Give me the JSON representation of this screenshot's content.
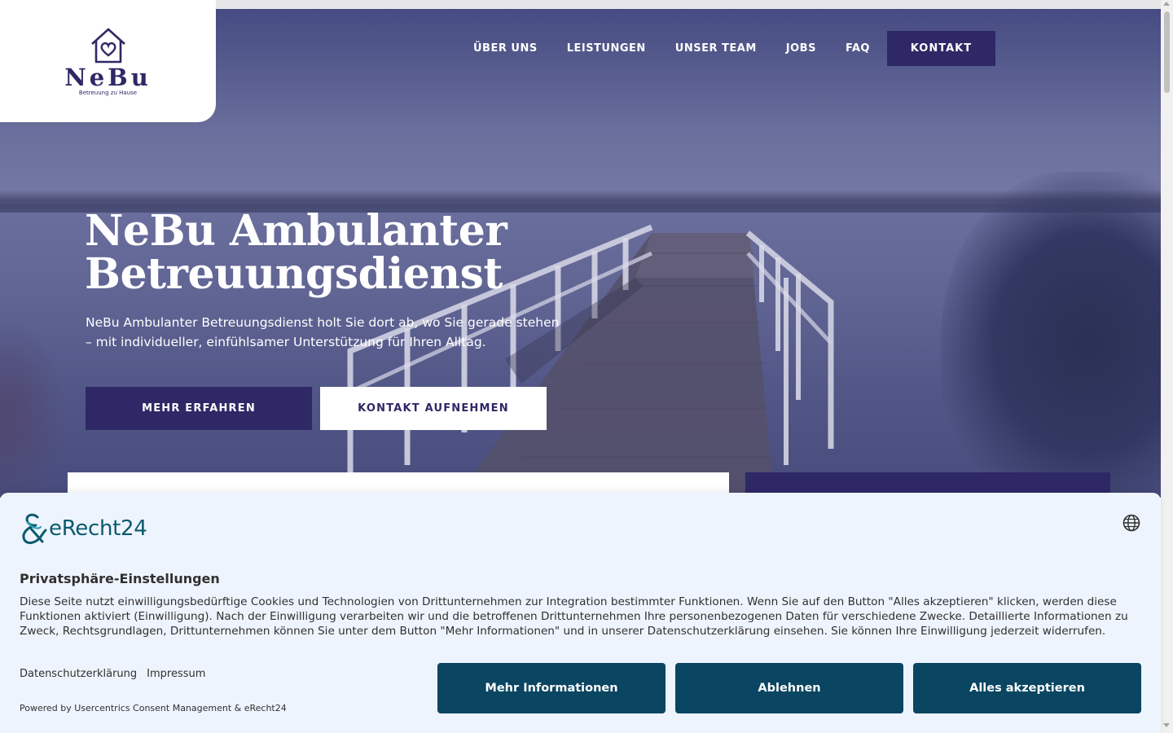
{
  "logo": {
    "name": "NeBu",
    "tagline": "Betreuung zu Hause"
  },
  "nav": {
    "items": [
      {
        "label": "ÜBER UNS"
      },
      {
        "label": "LEISTUNGEN"
      },
      {
        "label": "UNSER TEAM"
      },
      {
        "label": "JOBS"
      },
      {
        "label": "FAQ"
      }
    ],
    "cta": "KONTAKT"
  },
  "hero": {
    "title_line1": "NeBu Ambulanter",
    "title_line2": "Betreuungsdienst",
    "lead": "NeBu Ambulanter Betreuungsdienst holt Sie dort ab, wo Sie gerade stehen – mit individueller, einfühlsamer Unterstützung für Ihren Alltag.",
    "btn_more": "MEHR ERFAHREN",
    "btn_contact": "KONTAKT AUFNEHMEN"
  },
  "consent": {
    "brand": "eRecht24",
    "title": "Privatsphäre-Einstellungen",
    "text": "Diese Seite nutzt einwilligungsbedürftige Cookies und Technologien von Drittunternehmen zur Integration bestimmter Funktionen. Wenn Sie auf den Button \"Alles akzeptieren\" klicken, werden diese Funktionen aktiviert (Einwilligung). Nach der Einwilligung verarbeiten wir und die betroffenen Drittunternehmen Ihre personenbezogenen Daten für verschiedene Zwecke. Detaillierte Informationen zu Zweck, Rechtsgrundlagen, Drittunternehmen können Sie unter dem Button \"Mehr Informationen\" und in unserer Datenschutzerklärung einsehen. Sie können Ihre Einwilligung jederzeit widerrufen.",
    "link_privacy": "Datenschutzerklärung",
    "link_imprint": "Impressum",
    "powered": "Powered by Usercentrics Consent Management & eRecht24",
    "btn_more": "Mehr Informationen",
    "btn_deny": "Ablehnen",
    "btn_accept": "Alles akzeptieren"
  },
  "colors": {
    "brand_purple": "#2e2867",
    "consent_button": "#0a4561",
    "consent_bg": "#eef4fd",
    "erecht_teal": "#0b5a6e"
  },
  "icons": {
    "logo": "house-heart-icon",
    "language": "globe-icon"
  }
}
